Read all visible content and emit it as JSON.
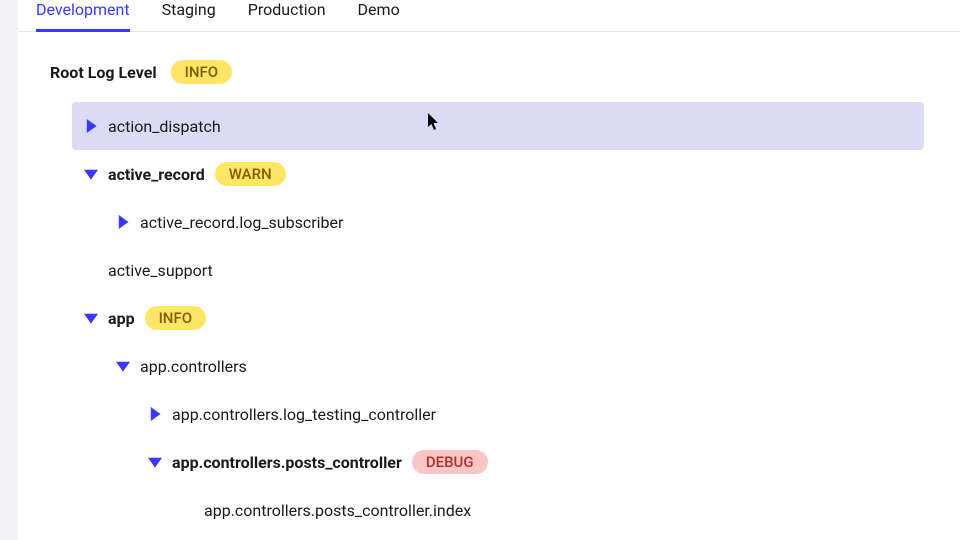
{
  "tabs": [
    {
      "label": "Development",
      "active": true
    },
    {
      "label": "Staging",
      "active": false
    },
    {
      "label": "Production",
      "active": false
    },
    {
      "label": "Demo",
      "active": false
    }
  ],
  "root": {
    "label": "Root Log Level",
    "badge": "INFO"
  },
  "tree": {
    "action_dispatch": {
      "label": "action_dispatch"
    },
    "active_record": {
      "label": "active_record",
      "badge": "WARN"
    },
    "active_record_log_subscriber": {
      "label": "active_record.log_subscriber"
    },
    "active_support": {
      "label": "active_support"
    },
    "app": {
      "label": "app",
      "badge": "INFO"
    },
    "app_controllers": {
      "label": "app.controllers"
    },
    "app_controllers_log_testing": {
      "label": "app.controllers.log_testing_controller"
    },
    "app_controllers_posts": {
      "label": "app.controllers.posts_controller",
      "badge": "DEBUG"
    },
    "app_controllers_posts_index": {
      "label": "app.controllers.posts_controller.index"
    }
  },
  "colors": {
    "accent": "#3b38ff",
    "highlight": "#dbdbf5",
    "badge_yellow": "#ffe666",
    "badge_pink": "#f9c5c5"
  }
}
